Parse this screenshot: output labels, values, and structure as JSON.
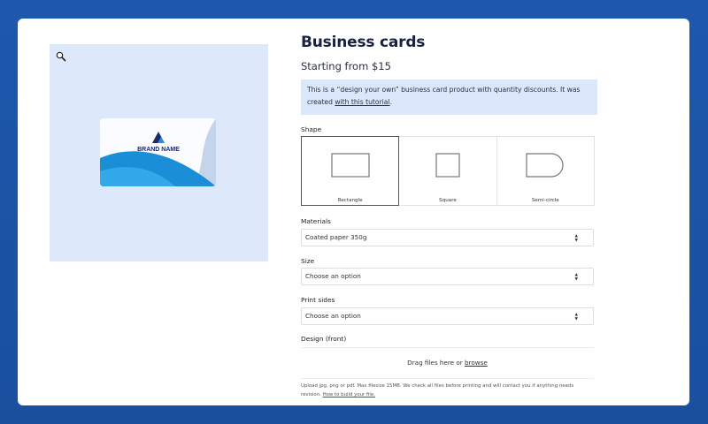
{
  "product": {
    "title": "Business cards",
    "price": "Starting from $15",
    "notice_text": "This is a “design your own” business card product with quantity discounts. It was created ",
    "notice_link": "with this tutorial",
    "notice_end": ".",
    "image_brand": "BRAND NAME"
  },
  "shape": {
    "label": "Shape",
    "options": [
      {
        "name": "Rectangle",
        "icon": "rectangle-shape-icon",
        "selected": true
      },
      {
        "name": "Square",
        "icon": "square-shape-icon",
        "selected": false
      },
      {
        "name": "Semi-circle",
        "icon": "semi-circle-shape-icon",
        "selected": false
      }
    ]
  },
  "materials": {
    "label": "Materials",
    "value": "Coated paper 350g"
  },
  "size": {
    "label": "Size",
    "value": "Choose an option"
  },
  "print_sides": {
    "label": "Print sides",
    "value": "Choose an option"
  },
  "design": {
    "label": "Design (front)",
    "drop_text": "Drag files here or ",
    "browse": "browse",
    "hint": "Upload jpg, png or pdf. Max filesize 15MB. We check all files before printing and will contact you if anything needs revision. ",
    "hint_link": "How to build your file."
  },
  "colors": {
    "background": "#1c56a8",
    "notice": "#dbe7fb",
    "gallery": "#dde9fb",
    "title": "#1b2140"
  }
}
